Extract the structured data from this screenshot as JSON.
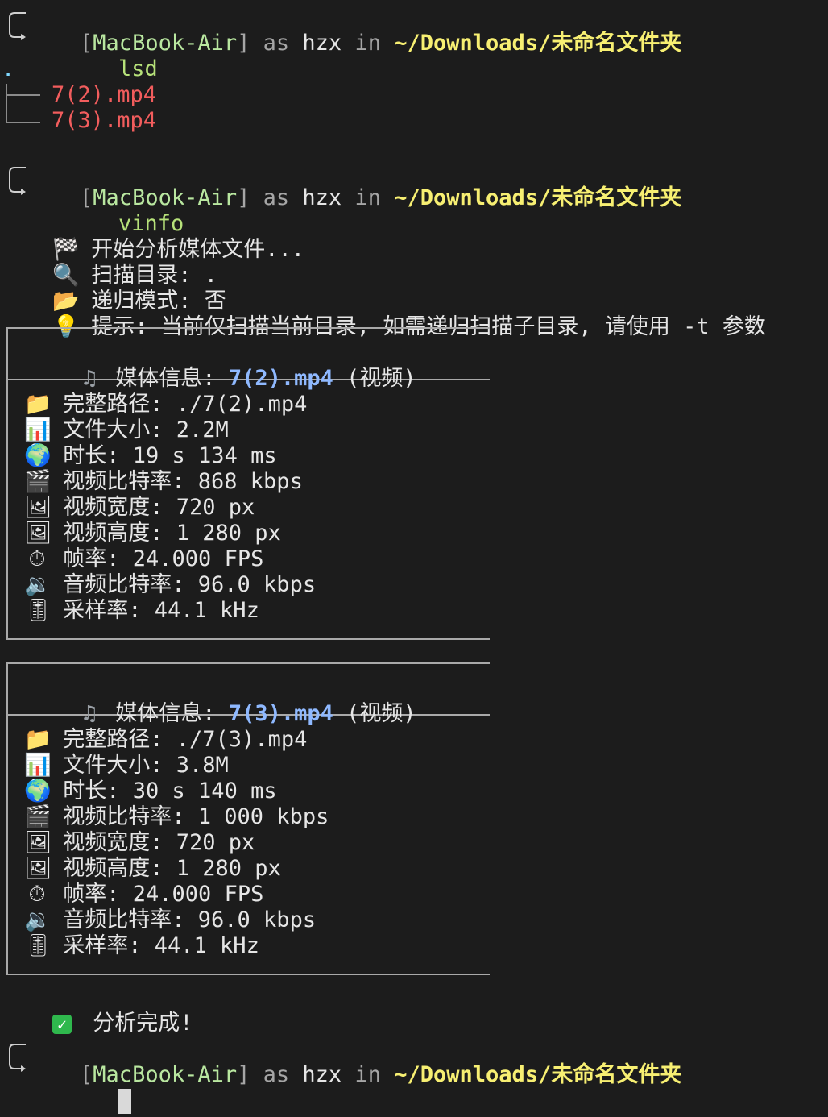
{
  "prompts": [
    {
      "host": "MacBook-Air",
      "as": "as",
      "user": "hzx",
      "in": "in",
      "cwd": "~/Downloads/未命名文件夹",
      "command": "lsd"
    },
    {
      "host": "MacBook-Air",
      "as": "as",
      "user": "hzx",
      "in": "in",
      "cwd": "~/Downloads/未命名文件夹",
      "command": "vinfo"
    },
    {
      "host": "MacBook-Air",
      "as": "as",
      "user": "hzx",
      "in": "in",
      "cwd": "~/Downloads/未命名文件夹",
      "command": ""
    }
  ],
  "lsd": {
    "root": ".",
    "files": [
      "7(2).mp4",
      "7(3).mp4"
    ]
  },
  "vinfo": {
    "header": [
      {
        "icon": "checkered-flag",
        "text": "开始分析媒体文件..."
      },
      {
        "icon": "magnifier",
        "text": "扫描目录: ."
      },
      {
        "icon": "open-folder",
        "text": "递归模式: 否"
      },
      {
        "icon": "lightbulb",
        "text": "提示: 当前仅扫描当前目录, 如需递归扫描子目录, 请使用 -t 参数"
      }
    ],
    "media": [
      {
        "title_label": "媒体信息:",
        "file": "7(2).mp4",
        "kind": "(视频)",
        "rows": [
          {
            "icon": "folder",
            "text": "完整路径: ./7(2).mp4"
          },
          {
            "icon": "bar-chart",
            "text": "文件大小: 2.2M"
          },
          {
            "icon": "globe",
            "text": "时长: 19 s 134 ms"
          },
          {
            "icon": "clapper",
            "text": "视频比特率: 868 kbps"
          },
          {
            "icon": "picture",
            "text": "视频宽度: 720 px"
          },
          {
            "icon": "picture",
            "text": "视频高度: 1 280 px"
          },
          {
            "icon": "stopwatch",
            "text": "帧率: 24.000 FPS"
          },
          {
            "icon": "speaker",
            "text": "音频比特率: 96.0 kbps"
          },
          {
            "icon": "slider",
            "text": "采样率: 44.1 kHz"
          }
        ]
      },
      {
        "title_label": "媒体信息:",
        "file": "7(3).mp4",
        "kind": "(视频)",
        "rows": [
          {
            "icon": "folder",
            "text": "完整路径: ./7(3).mp4"
          },
          {
            "icon": "bar-chart",
            "text": "文件大小: 3.8M"
          },
          {
            "icon": "globe",
            "text": "时长: 30 s 140 ms"
          },
          {
            "icon": "clapper",
            "text": "视频比特率: 1 000 kbps"
          },
          {
            "icon": "picture",
            "text": "视频宽度: 720 px"
          },
          {
            "icon": "picture",
            "text": "视频高度: 1 280 px"
          },
          {
            "icon": "stopwatch",
            "text": "帧率: 24.000 FPS"
          },
          {
            "icon": "speaker",
            "text": "音频比特率: 96.0 kbps"
          },
          {
            "icon": "slider",
            "text": "采样率: 44.1 kHz"
          }
        ]
      }
    ],
    "done": "分析完成!"
  },
  "colors": {
    "background": "#1c1c1c",
    "host": "#b9e7a0",
    "cwd": "#f7ef72",
    "command": "#b7e27a",
    "file": "#f25d5d",
    "media_file": "#8fb9ff"
  }
}
